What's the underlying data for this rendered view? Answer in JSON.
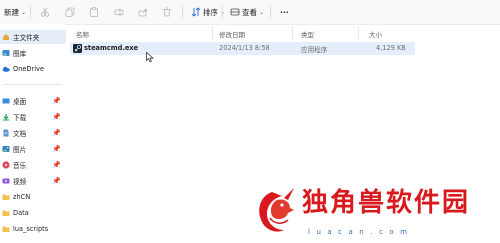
{
  "toolbar": {
    "new_label": "新建",
    "sort_label": "排序",
    "view_label": "查看",
    "more_label": "···"
  },
  "sidebar": {
    "items": [
      {
        "label": "主文件夹",
        "icon": "home-icon",
        "pinned": false
      },
      {
        "label": "图库",
        "icon": "gallery-icon",
        "pinned": false
      },
      {
        "label": "OneDrive",
        "icon": "cloud-icon",
        "pinned": false
      },
      {
        "label": "桌面",
        "icon": "desktop-icon",
        "pinned": true
      },
      {
        "label": "下载",
        "icon": "download-icon",
        "pinned": true
      },
      {
        "label": "文档",
        "icon": "document-icon",
        "pinned": true
      },
      {
        "label": "图片",
        "icon": "picture-icon",
        "pinned": true
      },
      {
        "label": "音乐",
        "icon": "music-icon",
        "pinned": true
      },
      {
        "label": "视频",
        "icon": "video-icon",
        "pinned": true
      },
      {
        "label": "zhCN",
        "icon": "folder-icon",
        "pinned": false
      },
      {
        "label": "Data",
        "icon": "folder-icon",
        "pinned": false
      },
      {
        "label": "lua_scripts",
        "icon": "folder-icon",
        "pinned": false
      }
    ]
  },
  "columns": {
    "name": "名称",
    "date": "修改日期",
    "type": "类型",
    "size": "大小"
  },
  "files": [
    {
      "name": "steamcmd.exe",
      "date": "2024/1/13 8:58",
      "type": "应用程序",
      "size": "4,129 KB"
    }
  ],
  "watermark": {
    "brand": "独角兽软件园",
    "url": "luacan.com"
  },
  "colors": {
    "accent": "#d8191d",
    "selection": "#e4effb",
    "sidebar_selected": "#e5eef8"
  }
}
